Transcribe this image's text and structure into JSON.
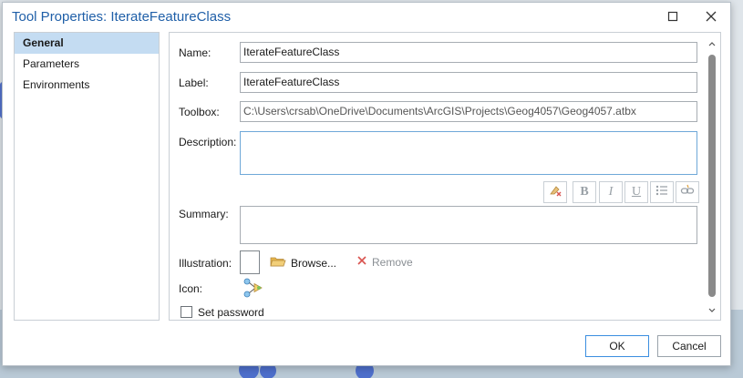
{
  "window": {
    "title": "Tool Properties: IterateFeatureClass"
  },
  "nav": {
    "items": [
      {
        "label": "General"
      },
      {
        "label": "Parameters"
      },
      {
        "label": "Environments"
      }
    ]
  },
  "form": {
    "name_label": "Name:",
    "name_value": "IterateFeatureClass",
    "label_label": "Label:",
    "label_value": "IterateFeatureClass",
    "toolbox_label": "Toolbox:",
    "toolbox_value": "C:\\Users\\crsab\\OneDrive\\Documents\\ArcGIS\\Projects\\Geog4057\\Geog4057.atbx",
    "description_label": "Description:",
    "description_value": "",
    "summary_label": "Summary:",
    "summary_value": "",
    "illustration_label": "Illustration:",
    "browse_label": "Browse...",
    "remove_label": "Remove",
    "icon_label": "Icon:",
    "set_password_label": "Set password",
    "set_password_checked": false
  },
  "format_toolbar": {
    "bold": "B",
    "italic": "I",
    "underline": "U"
  },
  "buttons": {
    "ok": "OK",
    "cancel": "Cancel"
  },
  "colors": {
    "title": "#1f5fa8",
    "selected_nav": "#c4dcf2",
    "primary_border": "#3b8ee0",
    "remove_icon": "#d9534f"
  }
}
